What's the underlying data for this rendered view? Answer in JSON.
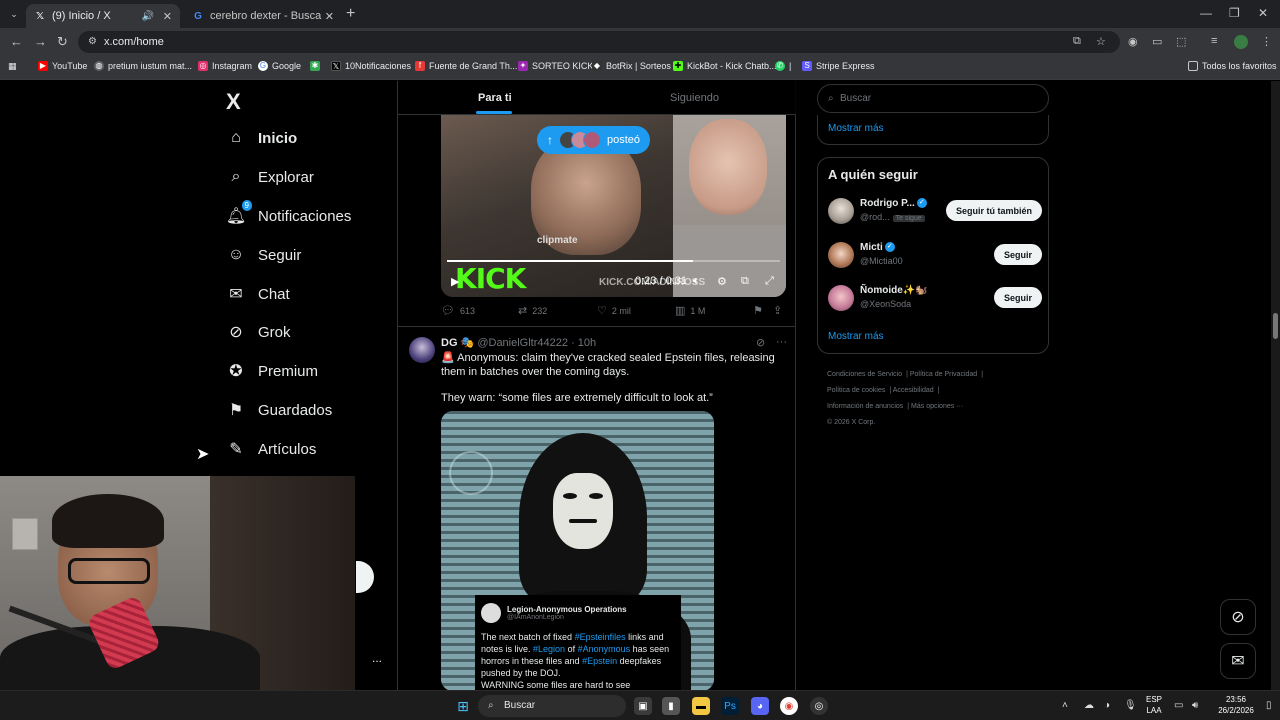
{
  "browser": {
    "tabs": [
      {
        "title": "(9) Inicio / X",
        "active": true
      },
      {
        "title": "cerebro dexter - Buscar con Go",
        "active": false
      }
    ],
    "url": "x.com/home",
    "bookmarks": [
      {
        "label": "YouTube",
        "color": "#ff0000"
      },
      {
        "label": "pretium iustum mat...",
        "color": "#5f6368"
      },
      {
        "label": "Instagram",
        "color": "#e1306c"
      },
      {
        "label": "Google",
        "color": "#4285f4"
      },
      {
        "label": "",
        "color": "#34a853"
      },
      {
        "label": "10Notificaciones",
        "color": "#000000"
      },
      {
        "label": "Fuente de Grand Th...",
        "color": "#e53935"
      },
      {
        "label": "SORTEO KICK",
        "color": "#9c27b0"
      },
      {
        "label": "BotRix | Sorteos",
        "color": "#333333"
      },
      {
        "label": "KickBot - Kick Chatb...",
        "color": "#53fc18"
      },
      {
        "label": "|",
        "color": "#25d366"
      },
      {
        "label": "Stripe Express",
        "color": "#635bff"
      }
    ],
    "all_bookmarks": "Todos los favoritos"
  },
  "nav": {
    "logo": "X",
    "items": [
      {
        "label": "Inicio",
        "icon": "home-icon",
        "active": true
      },
      {
        "label": "Explorar",
        "icon": "search-icon"
      },
      {
        "label": "Notificaciones",
        "icon": "bell-icon",
        "badge": "9"
      },
      {
        "label": "Seguir",
        "icon": "person-add-icon"
      },
      {
        "label": "Chat",
        "icon": "mail-icon"
      },
      {
        "label": "Grok",
        "icon": "grok-icon"
      },
      {
        "label": "Premium",
        "icon": "verified-icon"
      },
      {
        "label": "Guardados",
        "icon": "bookmark-icon"
      },
      {
        "label": "Artículos",
        "icon": "article-icon"
      }
    ],
    "more": "..."
  },
  "feed": {
    "tabs": [
      "Para ti",
      "Siguiendo"
    ],
    "posted_pill": "posteó",
    "video": {
      "watermark": "clipmate",
      "kick_logo": "KICK",
      "kick_url": "KICK.COM/ADINROSS",
      "time": "0:23 / 0:31",
      "progress": 0.74
    },
    "tweet1_actions": {
      "replies": "613",
      "reposts": "232",
      "likes": "2 mil",
      "views": "1 M"
    },
    "tweet2": {
      "name": "DG",
      "handle": "@DanielGltr44222",
      "time": "· 10h",
      "line1": "🚨 Anonymous: claim they've cracked sealed Epstein files, releasing them in batches over the coming days.",
      "line2": "They warn: “some files are extremely difficult to look at.”",
      "quote": {
        "name": "Legion-Anonymous Operations",
        "handle": "@IAmAnonLegion",
        "text_parts": [
          "The next batch of fixed ",
          "#Epsteinfiles",
          " links and notes is live. ",
          "#Legion",
          " of ",
          "#Anonymous",
          " has seen horrors in these files and ",
          "#Epstein",
          " deepfakes pushed by the DOJ.",
          "WARNING some files are hard to see"
        ]
      }
    }
  },
  "sidebar": {
    "search_placeholder": "Buscar",
    "show_more": "Mostrar más",
    "who_to_follow": "A quién seguir",
    "users": [
      {
        "name": "Rodrigo P...",
        "handle": "@rod...",
        "tag": "Te sigue",
        "verified": true,
        "button": "Seguir tú también"
      },
      {
        "name": "Micti",
        "handle": "@Mictia00",
        "verified": true,
        "button": "Seguir"
      },
      {
        "name": "Ñomoide✨🐿️",
        "handle": "@XeonSoda",
        "verified": false,
        "button": "Seguir"
      }
    ],
    "show_more2": "Mostrar más",
    "footer": [
      "Condiciones de Servicio",
      "Política de Privacidad",
      "Política de cookies",
      "Accesibilidad",
      "Información de anuncios",
      "Más opciones ···",
      "© 2026 X Corp."
    ]
  },
  "taskbar": {
    "search": "Buscar",
    "lang": [
      "ESP",
      "LAA"
    ],
    "time": "23:56",
    "date": "26/2/2026"
  }
}
